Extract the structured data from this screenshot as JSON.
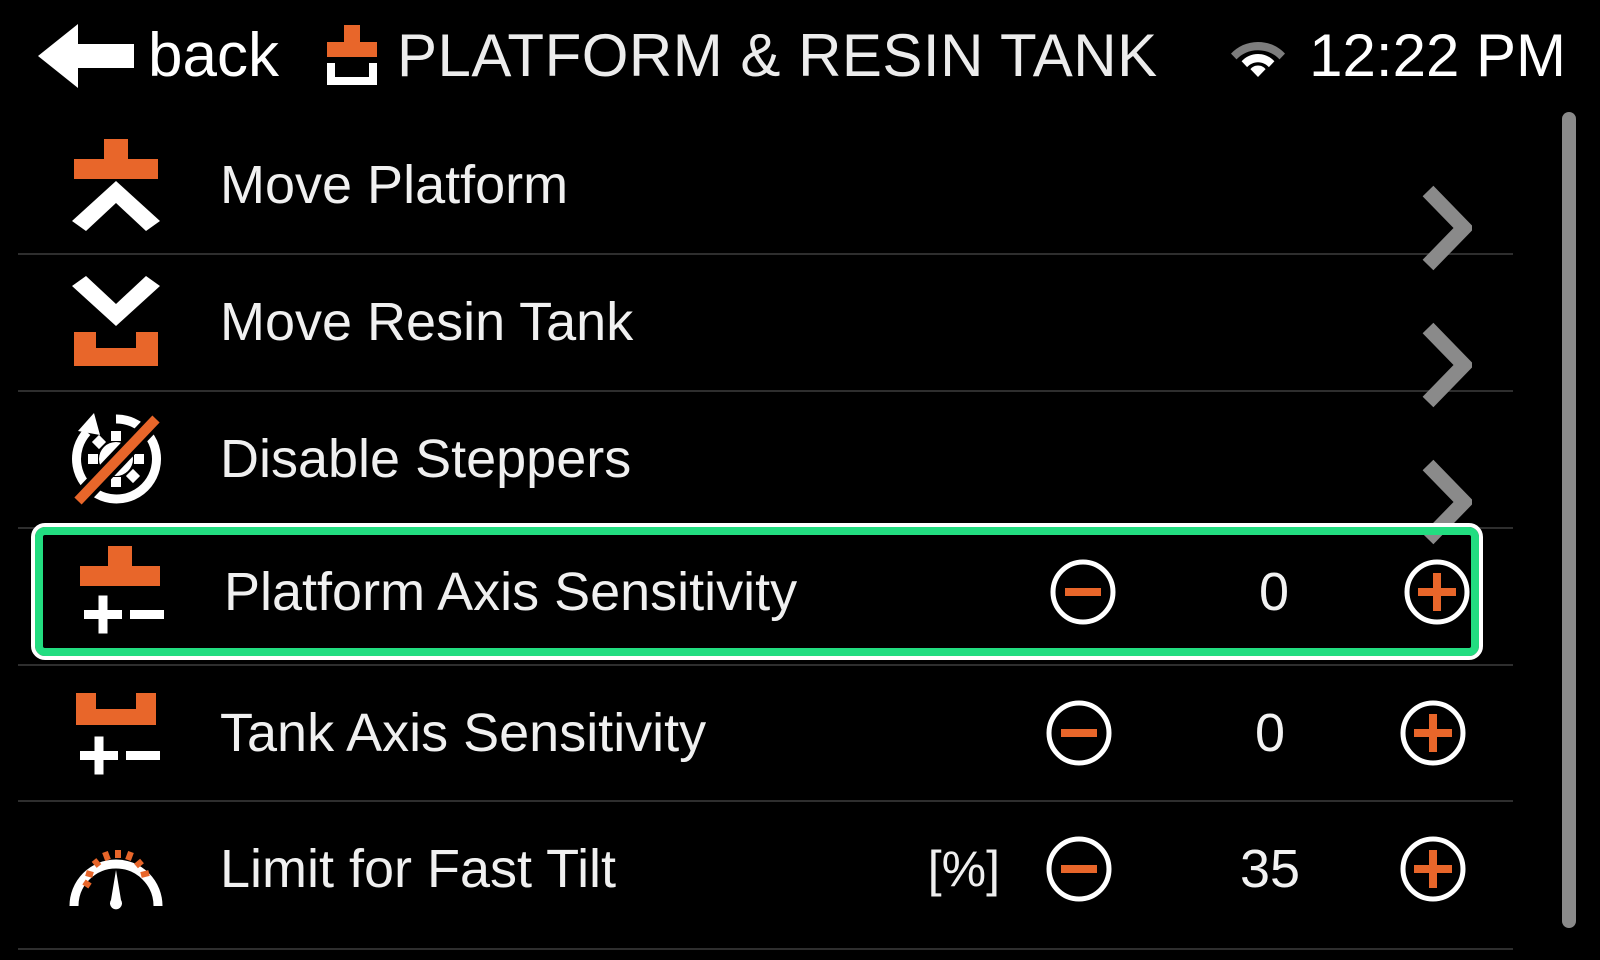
{
  "header": {
    "back_label": "back",
    "back_icon": "arrow-left-icon",
    "title_icon": "platform-resin-tank-icon",
    "title": "PLATFORM & RESIN TANK",
    "wifi_icon": "wifi-icon",
    "time": "12:22 PM"
  },
  "theme": {
    "background": "#000000",
    "accent_orange": "#e8662a",
    "text": "#f0f0f0",
    "chevron_gray": "#8a8a8a",
    "divider": "#2e2e2e",
    "highlight_green": "#22dd80",
    "highlight_outline": "#ffffff",
    "scrollbar": "#8a8a8a"
  },
  "rows": [
    {
      "id": "move-platform",
      "icon": "move-platform-icon",
      "label": "Move Platform",
      "type": "navigation",
      "chevron_icon": "chevron-right-icon",
      "selected": false
    },
    {
      "id": "move-resin-tank",
      "icon": "move-resin-tank-icon",
      "label": "Move Resin Tank",
      "type": "navigation",
      "chevron_icon": "chevron-right-icon",
      "selected": false
    },
    {
      "id": "disable-steppers",
      "icon": "disable-steppers-icon",
      "label": "Disable Steppers",
      "type": "navigation",
      "chevron_icon": "chevron-right-icon",
      "selected": false
    },
    {
      "id": "platform-axis-sensitivity",
      "icon": "platform-axis-sensitivity-icon",
      "label": "Platform Axis Sensitivity",
      "type": "stepper",
      "unit": "",
      "value": "0",
      "minus_icon": "minus-circle-icon",
      "plus_icon": "plus-circle-icon",
      "selected": true
    },
    {
      "id": "tank-axis-sensitivity",
      "icon": "tank-axis-sensitivity-icon",
      "label": "Tank Axis Sensitivity",
      "type": "stepper",
      "unit": "",
      "value": "0",
      "minus_icon": "minus-circle-icon",
      "plus_icon": "plus-circle-icon",
      "selected": false
    },
    {
      "id": "limit-for-fast-tilt",
      "icon": "gauge-icon",
      "label": "Limit for Fast Tilt",
      "type": "stepper",
      "unit": "[%]",
      "value": "35",
      "minus_icon": "minus-circle-icon",
      "plus_icon": "plus-circle-icon",
      "selected": false
    }
  ],
  "scrollbar": {
    "name": "vertical-scrollbar"
  }
}
